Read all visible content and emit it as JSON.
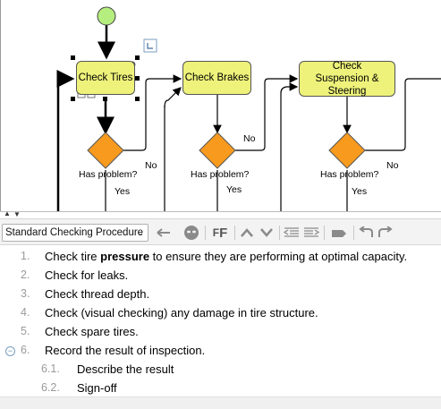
{
  "diagram": {
    "tasks": [
      {
        "label": "Check Tires"
      },
      {
        "label": "Check Brakes"
      },
      {
        "label": "Check Suspension & Steering"
      }
    ],
    "decision_label": "Has problem?",
    "yes_label": "Yes",
    "no_label": "No",
    "colors": {
      "task_fill": "#eef27a",
      "gateway_fill": "#f79a1e",
      "start_fill": "#b5ee7f"
    }
  },
  "toolbar": {
    "procedure_select": "Standard Checking Procedure",
    "icons": [
      "back-arrow-icon",
      "mask-icon",
      "font-format-icon",
      "move-up-icon",
      "move-down-icon",
      "outdent-icon",
      "indent-icon",
      "attach-icon",
      "undo-icon",
      "redo-icon"
    ]
  },
  "steps": [
    {
      "num": "1.",
      "pre": "Check tire ",
      "bold": "pressure",
      "post": " to ensure they are performing at optimal capacity."
    },
    {
      "num": "2.",
      "pre": "Check for leaks.",
      "bold": "",
      "post": ""
    },
    {
      "num": "3.",
      "pre": "Check thread depth.",
      "bold": "",
      "post": ""
    },
    {
      "num": "4.",
      "pre": "Check (visual checking) any damage in tire structure.",
      "bold": "",
      "post": ""
    },
    {
      "num": "5.",
      "pre": "Check spare tires.",
      "bold": "",
      "post": ""
    },
    {
      "num": "6.",
      "pre": "Record the result of inspection.",
      "bold": "",
      "post": ""
    },
    {
      "num": "6.1.",
      "pre": "Describe the result",
      "bold": "",
      "post": ""
    },
    {
      "num": "6.2.",
      "pre": "Sign-off",
      "bold": "",
      "post": ""
    }
  ]
}
